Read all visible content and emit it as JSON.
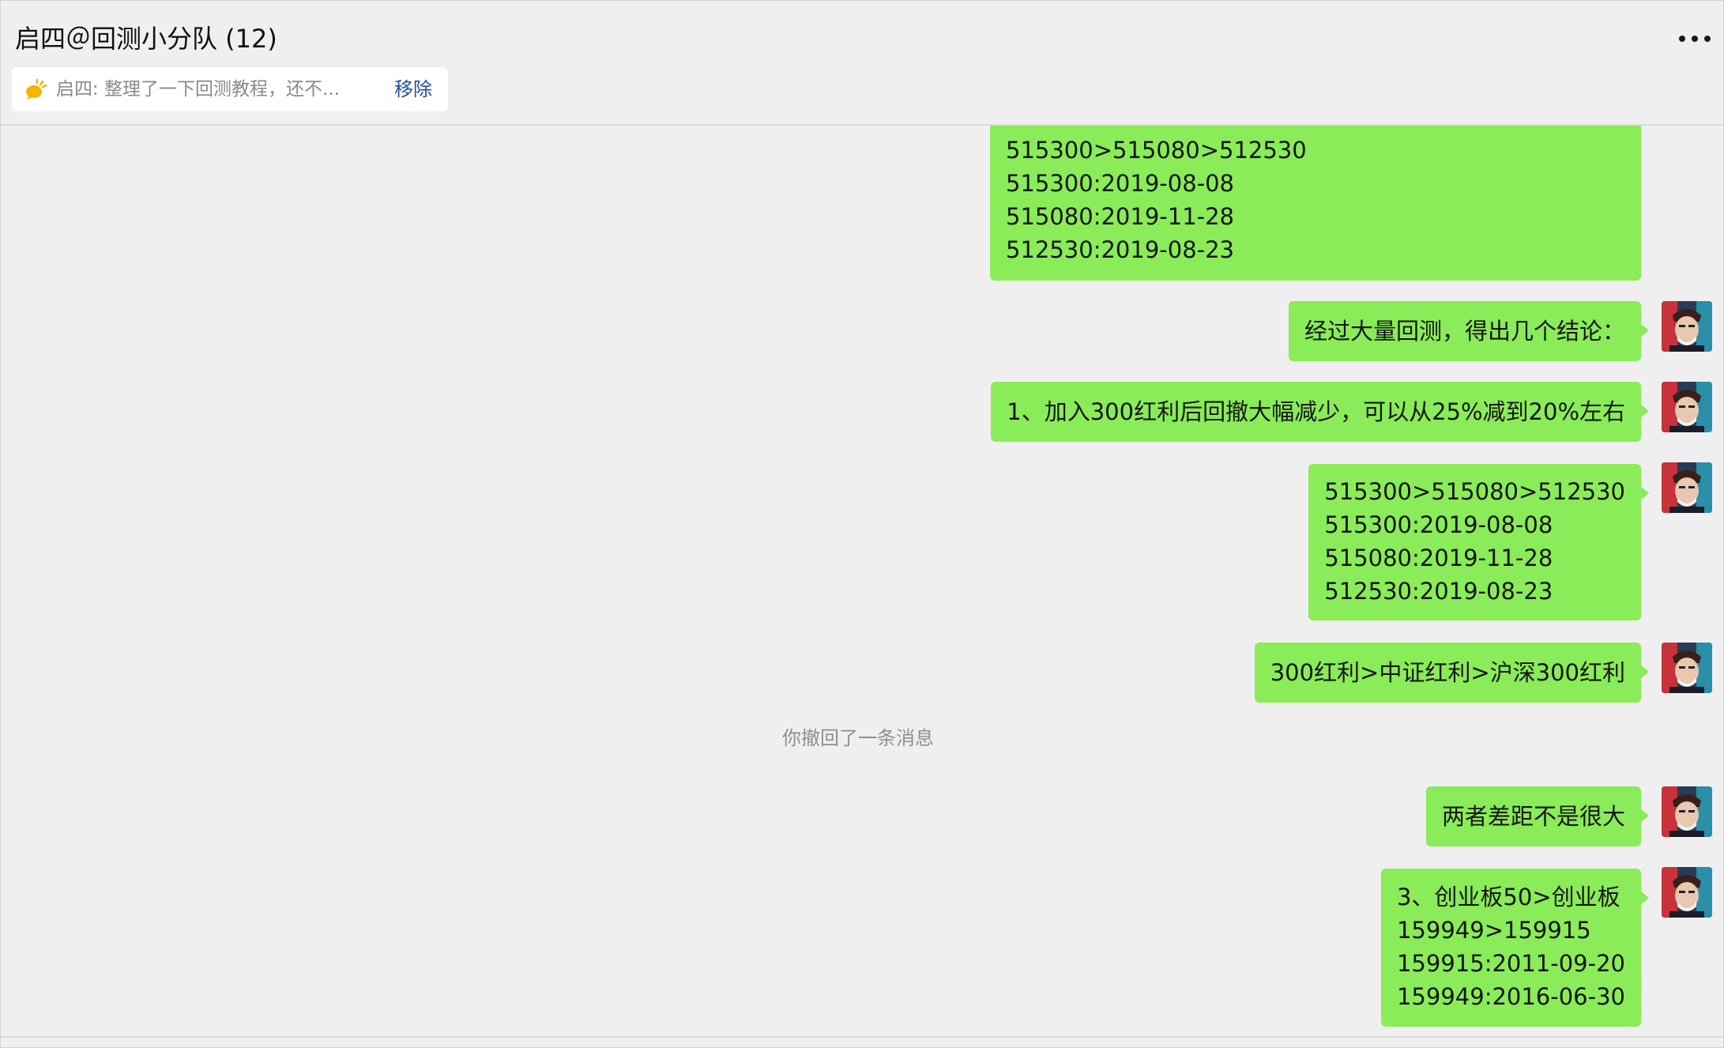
{
  "header": {
    "title": "启四＠回测小分队 (12)",
    "more_icon": "more-dots-icon"
  },
  "pinned": {
    "icon": "speech-bubble-icon",
    "icon_color": "#f5b400",
    "text": "启四: 整理了一下回测教程，还不...",
    "remove_label": "移除"
  },
  "messages": [
    {
      "lines": [
        "515300>515080>512530",
        "515300:2019-08-08",
        "515080:2019-11-28",
        "512530:2019-08-23"
      ]
    },
    {
      "lines": [
        "经过大量回测，得出几个结论："
      ]
    },
    {
      "lines": [
        "1、加入300红利后回撤大幅减少，可以从25%减到20%左右"
      ]
    },
    {
      "lines": [
        "515300>515080>512530",
        "515300:2019-08-08",
        "515080:2019-11-28",
        "512530:2019-08-23"
      ]
    },
    {
      "lines": [
        "300红利>中证红利>沪深300红利"
      ]
    },
    {
      "lines": [
        "两者差距不是很大"
      ]
    },
    {
      "lines": [
        "3、创业板50>创业板",
        "159949>159915",
        "159915:2011-09-20",
        "159949:2016-06-30"
      ]
    }
  ],
  "system_note": "你撤回了一条消息",
  "colors": {
    "bubble": "#89ec58",
    "background": "#efefef",
    "link": "#1f4d9e"
  }
}
